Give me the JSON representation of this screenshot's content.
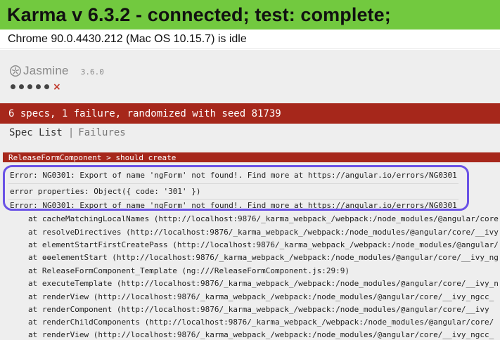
{
  "karma": {
    "title": "Karma v 6.3.2 - connected; test: complete;",
    "browser_status": "Chrome 90.0.4430.212 (Mac OS 10.15.7) is idle"
  },
  "jasmine": {
    "logo_text": "Jasmine",
    "version": "3.6.0",
    "failure_mark": "×",
    "summary": "6 specs, 1 failure, randomized with seed 81739",
    "menu": {
      "spec_list": "Spec List",
      "separator": "|",
      "failures": "Failures"
    },
    "spec_title": "ReleaseFormComponent > should create",
    "error_lines": [
      "Error: NG0301: Export of name 'ngForm' not found!. Find more at https://angular.io/errors/NG0301",
      "error properties: Object({ code: '301' })",
      "Error: NG0301: Export of name 'ngForm' not found!. Find more at https://angular.io/errors/NG0301"
    ],
    "stack_lines": [
      "at cacheMatchingLocalNames (http://localhost:9876/_karma_webpack_/webpack:/node_modules/@angular/core",
      "at resolveDirectives (http://localhost:9876/_karma_webpack_/webpack:/node_modules/@angular/core/__ivy",
      "at elementStartFirstCreatePass (http://localhost:9876/_karma_webpack_/webpack:/node_modules/@angular/",
      "at ɵɵelementStart (http://localhost:9876/_karma_webpack_/webpack:/node_modules/@angular/core/__ivy_ng",
      "at ReleaseFormComponent_Template (ng:///ReleaseFormComponent.js:29:9)",
      "at executeTemplate (http://localhost:9876/_karma_webpack_/webpack:/node_modules/@angular/core/__ivy_n",
      "at renderView (http://localhost:9876/_karma_webpack_/webpack:/node_modules/@angular/core/__ivy_ngcc_",
      "at renderComponent (http://localhost:9876/_karma_webpack_/webpack:/node_modules/@angular/core/__ivy",
      "at renderChildComponents (http://localhost:9876/_karma_webpack_/webpack:/node_modules/@angular/core/",
      "at renderView (http://localhost:9876/_karma_webpack_/webpack:/node_modules/@angular/core/__ivy_ngcc_"
    ]
  },
  "colors": {
    "karma_banner": "#72c93f",
    "failure_red": "#a6271b",
    "highlight_ring": "#6a52e6"
  }
}
